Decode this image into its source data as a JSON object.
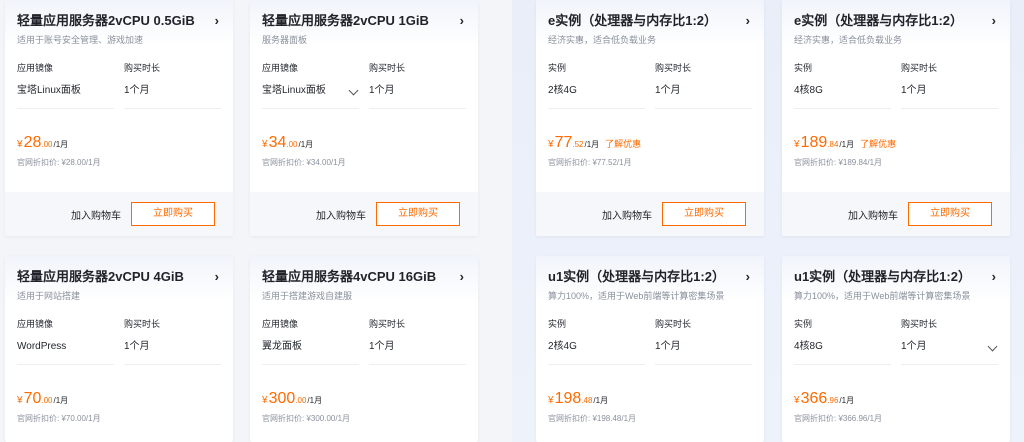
{
  "colors": {
    "accent": "#ff6a00",
    "text": "#1f2329",
    "muted": "#8a909c"
  },
  "cards": [
    {
      "title": "轻量应用服务器2vCPU 0.5GiB",
      "subtitle": "适用于账号安全管理、游戏加速",
      "spec1_label": "应用镜像",
      "spec1_value": "宝塔Linux面板",
      "spec2_label": "购买时长",
      "spec2_value": "1个月",
      "currency": "¥",
      "price_int": "28",
      "price_dec": ".00",
      "price_unit": "/1月",
      "promo": "",
      "original": "官网折扣价: ¥28.00/1月",
      "cart_label": "加入购物车",
      "buy_label": "立即购买"
    },
    {
      "title": "轻量应用服务器2vCPU 1GiB",
      "subtitle": "服务器面板",
      "spec1_label": "应用镜像",
      "spec1_value": "宝塔Linux面板",
      "spec2_label": "购买时长",
      "spec2_value": "1个月",
      "currency": "¥",
      "price_int": "34",
      "price_dec": ".00",
      "price_unit": "/1月",
      "promo": "",
      "original": "官网折扣价: ¥34.00/1月",
      "cart_label": "加入购物车",
      "buy_label": "立即购买"
    },
    {
      "title": "e实例（处理器与内存比1:2）",
      "subtitle": "经济实惠，适合低负载业务",
      "spec1_label": "实例",
      "spec1_value": "2核4G",
      "spec2_label": "购买时长",
      "spec2_value": "1个月",
      "currency": "¥",
      "price_int": "77",
      "price_dec": ".52",
      "price_unit": "/1月",
      "promo": "了解优惠",
      "original": "官网折扣价: ¥77.52/1月",
      "cart_label": "加入购物车",
      "buy_label": "立即购买"
    },
    {
      "title": "e实例（处理器与内存比1:2）",
      "subtitle": "经济实惠，适合低负载业务",
      "spec1_label": "实例",
      "spec1_value": "4核8G",
      "spec2_label": "购买时长",
      "spec2_value": "1个月",
      "currency": "¥",
      "price_int": "189",
      "price_dec": ".84",
      "price_unit": "/1月",
      "promo": "了解优惠",
      "original": "官网折扣价: ¥189.84/1月",
      "cart_label": "加入购物车",
      "buy_label": "立即购买"
    },
    {
      "title": "轻量应用服务器2vCPU 4GiB",
      "subtitle": "适用于网站搭建",
      "spec1_label": "应用镜像",
      "spec1_value": "WordPress",
      "spec2_label": "购买时长",
      "spec2_value": "1个月",
      "currency": "¥",
      "price_int": "70",
      "price_dec": ".00",
      "price_unit": "/1月",
      "promo": "",
      "original": "官网折扣价: ¥70.00/1月"
    },
    {
      "title": "轻量应用服务器4vCPU 16GiB",
      "subtitle": "适用于搭建游戏自建服",
      "spec1_label": "应用镜像",
      "spec1_value": "翼龙面板",
      "spec2_label": "购买时长",
      "spec2_value": "1个月",
      "currency": "¥",
      "price_int": "300",
      "price_dec": ".00",
      "price_unit": "/1月",
      "promo": "",
      "original": "官网折扣价: ¥300.00/1月"
    },
    {
      "title": "u1实例（处理器与内存比1:2）",
      "subtitle": "算力100%，适用于Web前端等计算密集场景",
      "spec1_label": "实例",
      "spec1_value": "2核4G",
      "spec2_label": "购买时长",
      "spec2_value": "1个月",
      "currency": "¥",
      "price_int": "198",
      "price_dec": ".48",
      "price_unit": "/1月",
      "promo": "",
      "original": "官网折扣价: ¥198.48/1月"
    },
    {
      "title": "u1实例（处理器与内存比1:2）",
      "subtitle": "算力100%，适用于Web前端等计算密集场景",
      "spec1_label": "实例",
      "spec1_value": "4核8G",
      "spec2_label": "购买时长",
      "spec2_value": "1个月",
      "currency": "¥",
      "price_int": "366",
      "price_dec": ".96",
      "price_unit": "/1月",
      "promo": "",
      "original": "官网折扣价: ¥366.96/1月"
    }
  ]
}
